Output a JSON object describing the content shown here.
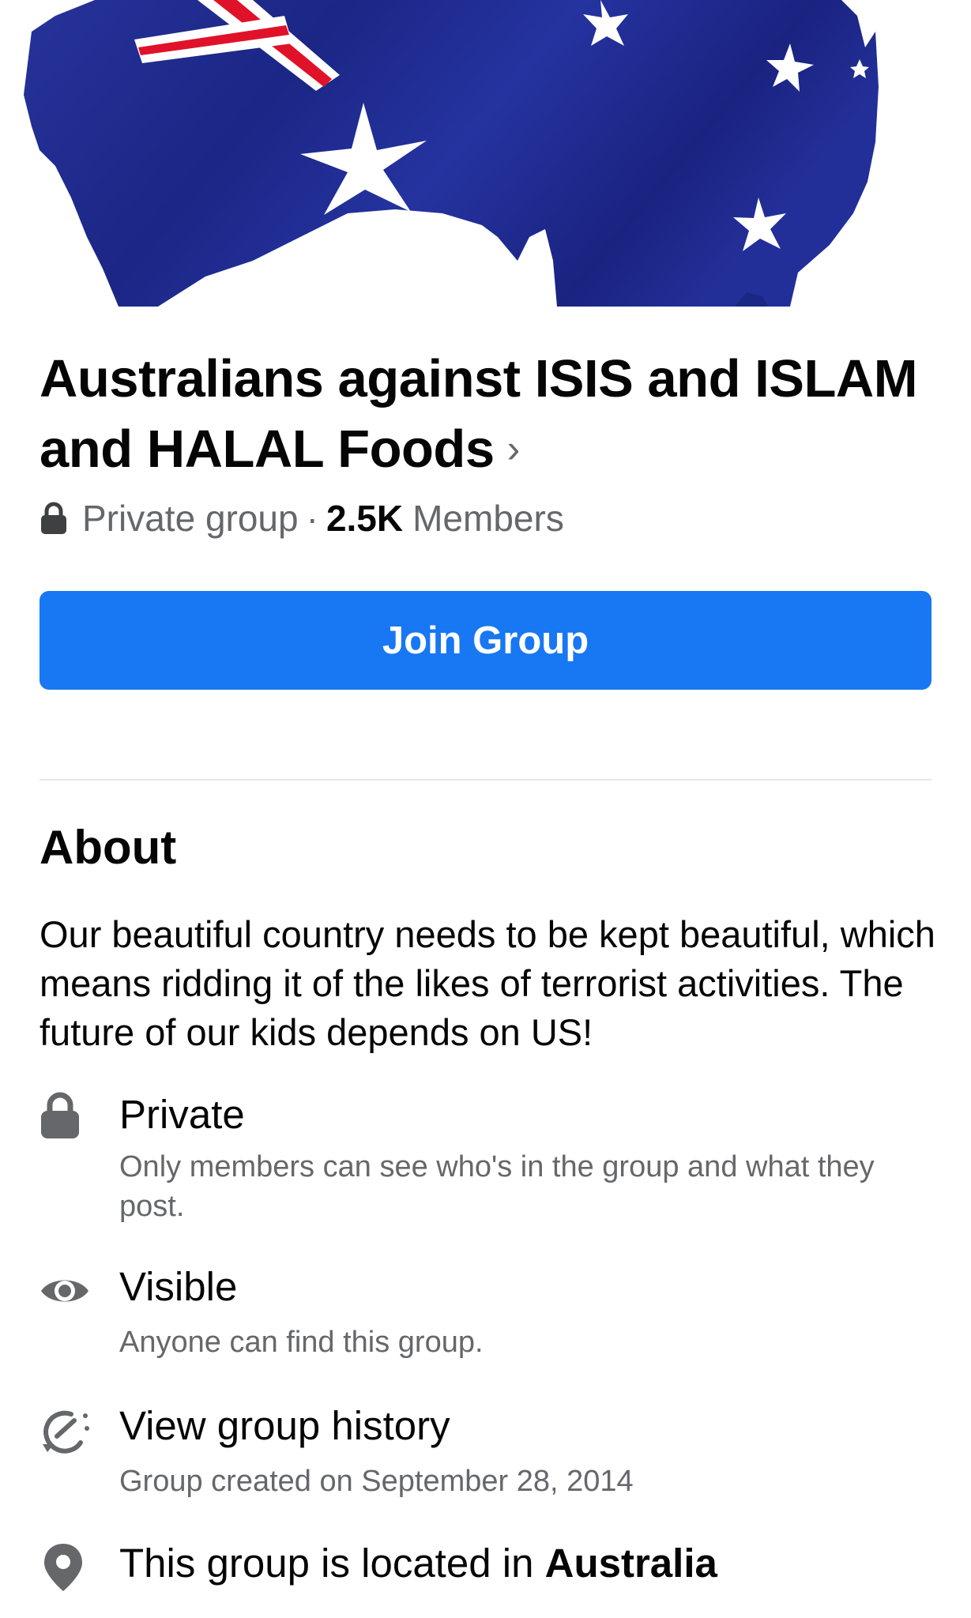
{
  "group": {
    "name": "Australians against ISIS and ISLAM and HALAL Foods",
    "chevron": "›",
    "privacy_label": "Private group",
    "separator": "·",
    "member_count": "2.5K",
    "members_label": "Members"
  },
  "actions": {
    "join_label": "Join Group"
  },
  "about": {
    "heading": "About",
    "description": "Our beautiful country needs to be kept beautiful, which means ridding it of the likes of terrorist activities. The future of our kids depends on US!",
    "items": [
      {
        "icon": "lock-icon",
        "title": "Private",
        "subtitle": "Only members can see who's in the group and what they post."
      },
      {
        "icon": "eye-icon",
        "title": "Visible",
        "subtitle": "Anyone can find this group."
      },
      {
        "icon": "history-icon",
        "title": "View group history",
        "subtitle": "Group created on September 28, 2014"
      },
      {
        "icon": "location-pin-icon",
        "title_prefix": "This group is located in",
        "title_location": "Australia"
      }
    ]
  },
  "colors": {
    "accent": "#1877f2",
    "secondary_text": "#65676b",
    "flag_blue": "#1e2a8f",
    "flag_red": "#e0122a"
  }
}
